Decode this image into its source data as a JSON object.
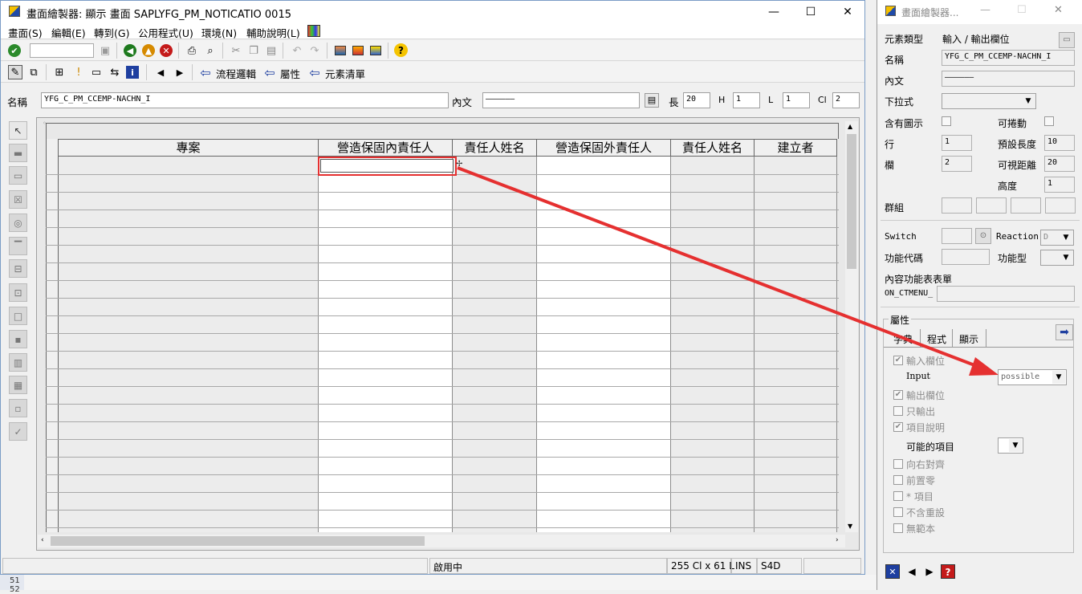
{
  "window": {
    "title": "畫面繪製器:  顯示 畫面 SAPLYFG_PM_NOTICATIO 0015",
    "minimize": "—",
    "maximize": "☐",
    "close": "✕"
  },
  "menu": [
    "畫面(S)",
    "編輯(E)",
    "轉到(G)",
    "公用程式(U)",
    "環境(N)",
    "輔助說明(L)"
  ],
  "toolbar2": {
    "flow_logic": "流程邏輯",
    "attributes": "屬性",
    "element_list": "元素清單"
  },
  "namebar": {
    "name_label": "名稱",
    "name_value": "YFG_C_PM_CCEMP-NACHN_I",
    "text_label": "內文",
    "text_value": "——————",
    "len_label": "長",
    "len_value": "20",
    "h_label": "H",
    "h_value": "1",
    "l_label": "L",
    "l_value": "1",
    "cl_label": "Cl",
    "cl_value": "2"
  },
  "table": {
    "headers": [
      "專案",
      "營造保固內責任人",
      "責任人姓名",
      "營造保固外責任人",
      "責任人姓名",
      "建立者"
    ]
  },
  "status": {
    "mode": "啟用中",
    "pos": "255 Cl x 61 L",
    "ins": "INS",
    "sys": "S4D"
  },
  "panel": {
    "title": "畫面繪製器...",
    "element_type_label": "元素類型",
    "element_type_value": "輸入 / 輸出欄位",
    "name_label": "名稱",
    "name_value": "YFG_C_PM_CCEMP-NACHN_I",
    "text_label": "內文",
    "text_value": "——————",
    "dropdown_label": "下拉式",
    "with_icon_label": "含有圖示",
    "scrollable_label": "可捲動",
    "row_label": "行",
    "row_value": "1",
    "def_len_label": "預設長度",
    "def_len_value": "10",
    "col_label": "欄",
    "col_value": "2",
    "vis_len_label": "可視距離",
    "vis_len_value": "20",
    "height_label": "高度",
    "height_value": "1",
    "group_label": "群組",
    "switch_label": "Switch",
    "reaction_label": "Reaction",
    "reaction_value": "D",
    "fcode_label": "功能代碼",
    "ftype_label": "功能型",
    "ctx_menu_label": "內容功能表表單",
    "ctx_menu_value": "ON_CTMENU_",
    "attrs_group": "屬性",
    "tabs": [
      "字典",
      "程式",
      "顯示"
    ],
    "input_field_label": "輸入欄位",
    "input_label": "Input",
    "input_value": "possible",
    "output_field_label": "輸出欄位",
    "output_only_label": "只輸出",
    "item_desc_label": "項目說明",
    "possible_items_label": "可能的項目",
    "right_align_label": "向右對齊",
    "leading_zero_label": "前置零",
    "star_item_label": "* 項目",
    "no_reset_label": "不含重設",
    "no_template_label": "無範本"
  },
  "bottom_left": {
    "line1": "51",
    "line2": "52"
  }
}
